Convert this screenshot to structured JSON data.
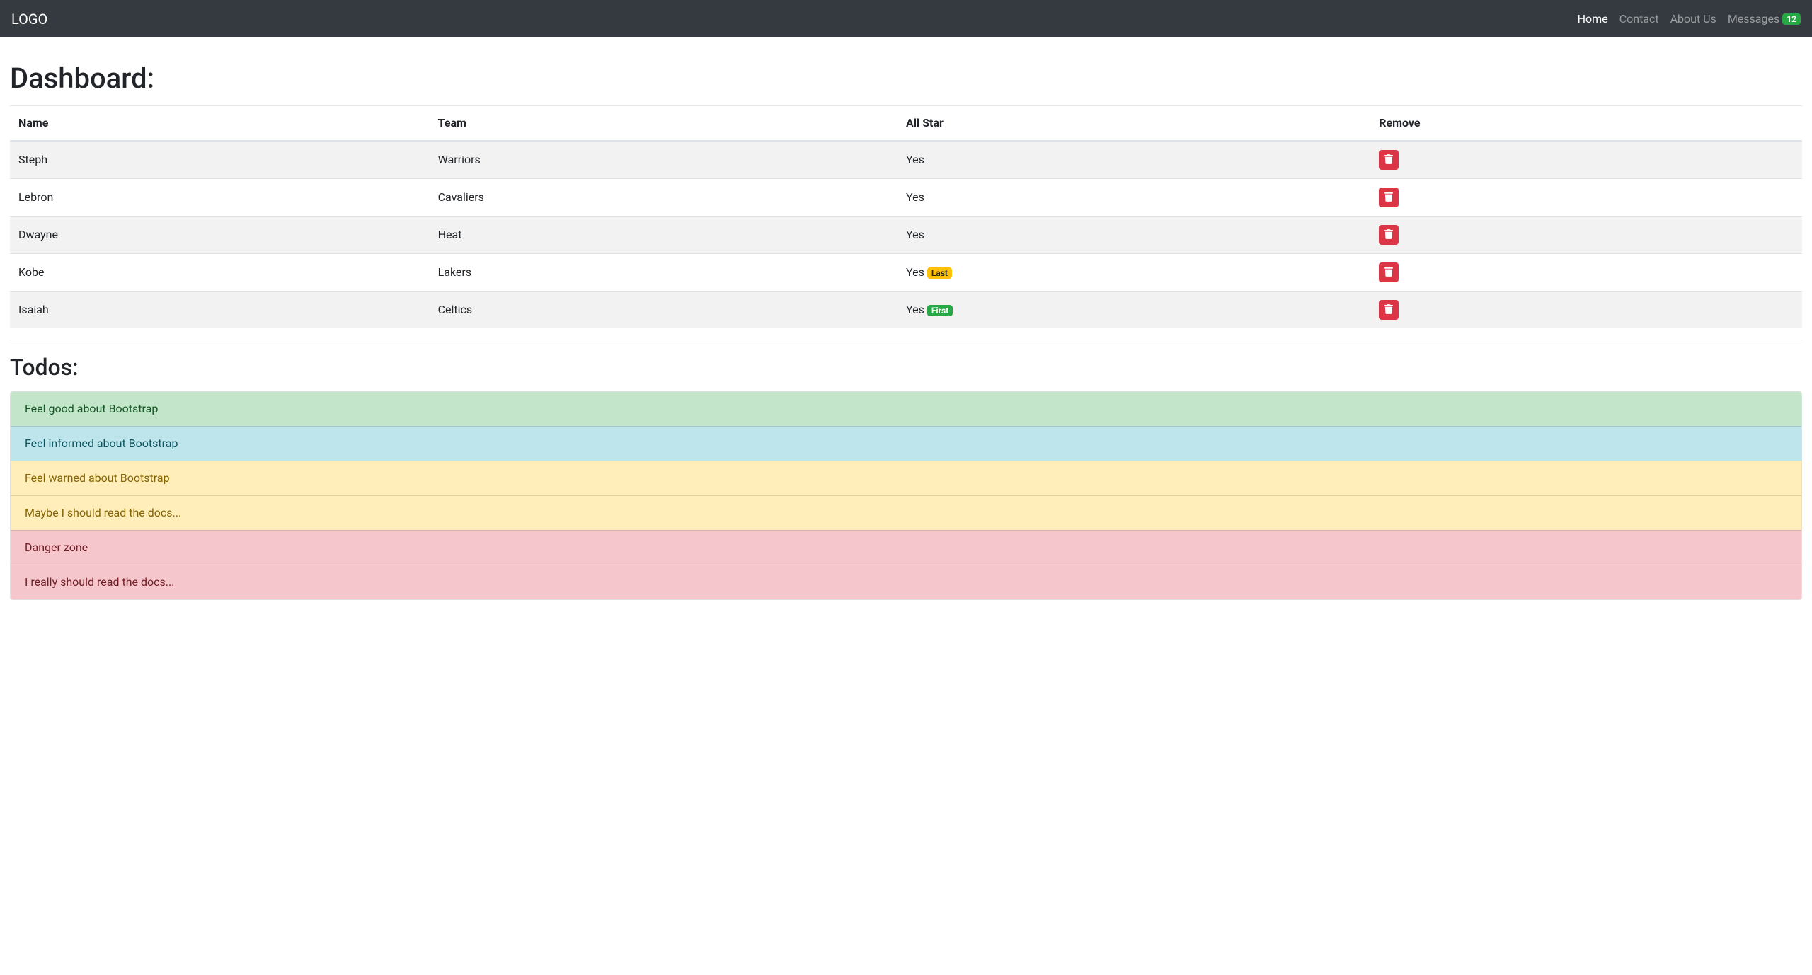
{
  "nav": {
    "brand": "LOGO",
    "items": [
      {
        "label": "Home",
        "active": true,
        "badge": null
      },
      {
        "label": "Contact",
        "active": false,
        "badge": null
      },
      {
        "label": "About Us",
        "active": false,
        "badge": null
      },
      {
        "label": "Messages",
        "active": false,
        "badge": "12"
      }
    ]
  },
  "headings": {
    "dashboard": "Dashboard:",
    "todos": "Todos:"
  },
  "table": {
    "columns": [
      "Name",
      "Team",
      "All Star",
      "Remove"
    ],
    "rows": [
      {
        "name": "Steph",
        "team": "Warriors",
        "allstar": "Yes",
        "badge": null,
        "badge_style": null
      },
      {
        "name": "Lebron",
        "team": "Cavaliers",
        "allstar": "Yes",
        "badge": null,
        "badge_style": null
      },
      {
        "name": "Dwayne",
        "team": "Heat",
        "allstar": "Yes",
        "badge": null,
        "badge_style": null
      },
      {
        "name": "Kobe",
        "team": "Lakers",
        "allstar": "Yes",
        "badge": "Last",
        "badge_style": "warning"
      },
      {
        "name": "Isaiah",
        "team": "Celtics",
        "allstar": "Yes",
        "badge": "First",
        "badge_style": "success"
      }
    ]
  },
  "todos": [
    {
      "text": "Feel good about Bootstrap",
      "style": "success"
    },
    {
      "text": "Feel informed about Bootstrap",
      "style": "info"
    },
    {
      "text": "Feel warned about Bootstrap",
      "style": "warning"
    },
    {
      "text": "Maybe I should read the docs...",
      "style": "warning"
    },
    {
      "text": "Danger zone",
      "style": "danger"
    },
    {
      "text": "I really should read the docs...",
      "style": "danger"
    }
  ]
}
